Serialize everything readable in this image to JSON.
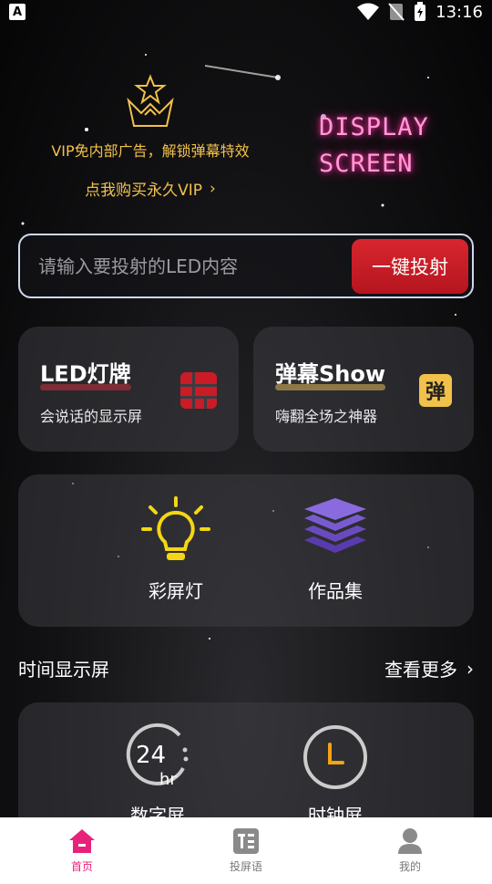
{
  "status_bar": {
    "time": "13:16",
    "app_icon_letter": "A"
  },
  "vip": {
    "description": "VIP免内部广告，解锁弹幕特效",
    "link_label": "点我购买永久VIP",
    "link_chevron": "›"
  },
  "banner_art": {
    "line1": "DISPLAY",
    "line2": "SCREEN"
  },
  "cast": {
    "placeholder": "请输入要投射的LED内容",
    "button_label": "一键投射"
  },
  "features": {
    "led": {
      "title": "LED灯牌",
      "subtitle": "会说话的显示屏"
    },
    "danmu": {
      "title": "弹幕Show",
      "subtitle": "嗨翻全场之神器",
      "icon_char": "弹"
    }
  },
  "tools": {
    "color_light": "彩屏灯",
    "works": "作品集"
  },
  "time_section": {
    "title": "时间显示屏",
    "more_label": "查看更多",
    "more_chevron": "›",
    "digital_label": "数字屏",
    "clock_label": "时钟屏",
    "digital_icon_text": "24",
    "digital_icon_unit": "hr",
    "clock_icon_text": "L"
  },
  "bottom_nav": {
    "home": "首页",
    "cast_text": "投屏语",
    "mine": "我的"
  },
  "colors": {
    "accent_gold": "#f2c14a",
    "accent_red": "#c91c27",
    "nav_active": "#e8227a"
  }
}
